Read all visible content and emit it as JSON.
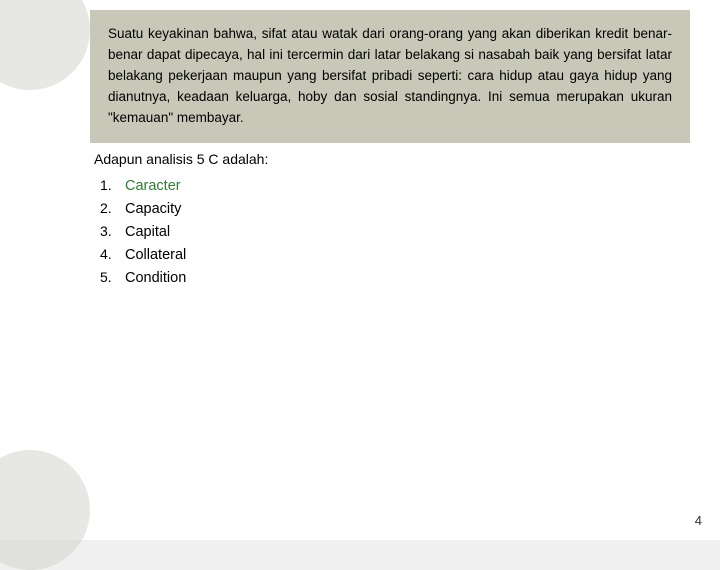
{
  "slide": {
    "page_number": "4",
    "deco_color": "#c8c8b4",
    "paragraph": {
      "text": "Suatu keyakinan bahwa, sifat atau watak dari orang-orang yang akan diberikan kredit benar-benar dapat dipecaya, hal ini tercermin dari latar belakang si nasabah baik yang bersifat latar belakang pekerjaan maupun yang bersifat pribadi seperti: cara hidup atau gaya hidup yang dianutnya, keadaan keluarga, hoby dan sosial standingnya. Ini semua merupakan ukuran \"kemauan\" membayar."
    },
    "analisis_heading": "Adapun analisis 5 C adalah:",
    "list_items": [
      {
        "number": "1.",
        "label": "Caracter",
        "colored": true
      },
      {
        "number": "2.",
        "label": "Capacity",
        "colored": false
      },
      {
        "number": "3.",
        "label": "Capital",
        "colored": false
      },
      {
        "number": "4.",
        "label": "Collateral",
        "colored": false
      },
      {
        "number": "5.",
        "label": "Condition",
        "colored": false
      }
    ]
  }
}
